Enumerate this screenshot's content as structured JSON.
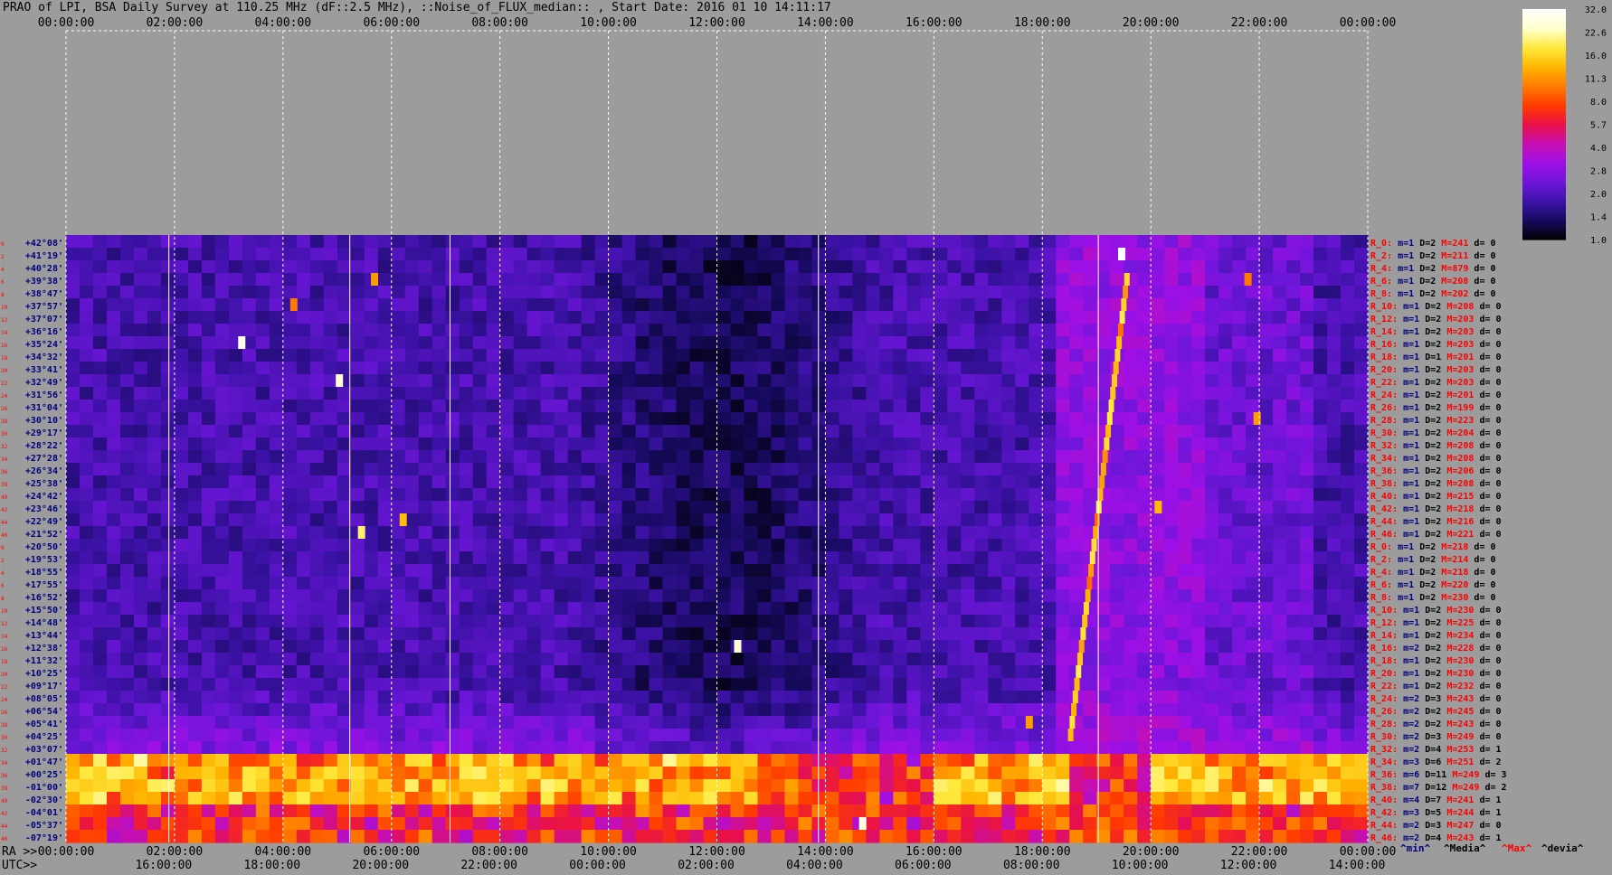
{
  "title": "PRAO of LPI, BSA Daily Survey at 110.25 MHz (dF::2.5 MHz), ::Noise_of_FLUX_median:: , Start Date: 2016 01 10 14:11:17",
  "chart_data": {
    "type": "heatmap",
    "title": "PRAO of LPI, BSA Daily Survey at 110.25 MHz (dF::2.5 MHz), ::Noise_of_FLUX_median:: , Start Date: 2016 01 10 14:11:17",
    "x_ra_ticks": [
      "00:00:00",
      "02:00:00",
      "04:00:00",
      "06:00:00",
      "08:00:00",
      "10:00:00",
      "12:00:00",
      "14:00:00",
      "16:00:00",
      "18:00:00",
      "20:00:00",
      "22:00:00",
      "00:00:00"
    ],
    "x_utc_ticks": [
      "16:00:00",
      "18:00:00",
      "20:00:00",
      "22:00:00",
      "00:00:00",
      "02:00:00",
      "04:00:00",
      "06:00:00",
      "08:00:00",
      "10:00:00",
      "12:00:00",
      "14:00:00"
    ],
    "ra_label": "RA >>",
    "utc_label": "UTC>>",
    "declinations": [
      "+42°08'",
      "+41°19'",
      "+40°28'",
      "+39°38'",
      "+38°47'",
      "+37°57'",
      "+37°07'",
      "+36°16'",
      "+35°24'",
      "+34°32'",
      "+33°41'",
      "+32°49'",
      "+31°56'",
      "+31°04'",
      "+30°10'",
      "+29°17'",
      "+28°22'",
      "+27°28'",
      "+26°34'",
      "+25°38'",
      "+24°42'",
      "+23°46'",
      "+22°49'",
      "+21°52'",
      "+20°50'",
      "+19°53'",
      "+18°55'",
      "+17°55'",
      "+16°52'",
      "+15°50'",
      "+14°48'",
      "+13°44'",
      "+12°38'",
      "+11°32'",
      "+10°25'",
      "+09°17'",
      "+08°05'",
      "+06°54'",
      "+05°41'",
      "+04°25'",
      "+03°07'",
      "+01°47'",
      "+00°25'",
      "-01°00'",
      "-02°30'",
      "-04°01'",
      "-05°37'",
      "-07°19'"
    ],
    "row_stats": [
      {
        "r": "R_0:",
        "m": "m=1",
        "D": "D=2",
        "M": "M=241",
        "d": "d= 0"
      },
      {
        "r": "R_2:",
        "m": "m=1",
        "D": "D=2",
        "M": "M=211",
        "d": "d= 0"
      },
      {
        "r": "R_4:",
        "m": "m=1",
        "D": "D=2",
        "M": "M=879",
        "d": "d= 0"
      },
      {
        "r": "R_6:",
        "m": "m=1",
        "D": "D=2",
        "M": "M=208",
        "d": "d= 0"
      },
      {
        "r": "R_8:",
        "m": "m=1",
        "D": "D=2",
        "M": "M=202",
        "d": "d= 0"
      },
      {
        "r": "R_10:",
        "m": "m=1",
        "D": "D=2",
        "M": "M=208",
        "d": "d= 0"
      },
      {
        "r": "R_12:",
        "m": "m=1",
        "D": "D=2",
        "M": "M=203",
        "d": "d= 0"
      },
      {
        "r": "R_14:",
        "m": "m=1",
        "D": "D=2",
        "M": "M=203",
        "d": "d= 0"
      },
      {
        "r": "R_16:",
        "m": "m=1",
        "D": "D=2",
        "M": "M=203",
        "d": "d= 0"
      },
      {
        "r": "R_18:",
        "m": "m=1",
        "D": "D=1",
        "M": "M=201",
        "d": "d= 0"
      },
      {
        "r": "R_20:",
        "m": "m=1",
        "D": "D=2",
        "M": "M=203",
        "d": "d= 0"
      },
      {
        "r": "R_22:",
        "m": "m=1",
        "D": "D=2",
        "M": "M=203",
        "d": "d= 0"
      },
      {
        "r": "R_24:",
        "m": "m=1",
        "D": "D=2",
        "M": "M=201",
        "d": "d= 0"
      },
      {
        "r": "R_26:",
        "m": "m=1",
        "D": "D=2",
        "M": "M=199",
        "d": "d= 0"
      },
      {
        "r": "R_28:",
        "m": "m=1",
        "D": "D=2",
        "M": "M=223",
        "d": "d= 0"
      },
      {
        "r": "R_30:",
        "m": "m=1",
        "D": "D=2",
        "M": "M=204",
        "d": "d= 0"
      },
      {
        "r": "R_32:",
        "m": "m=1",
        "D": "D=2",
        "M": "M=208",
        "d": "d= 0"
      },
      {
        "r": "R_34:",
        "m": "m=1",
        "D": "D=2",
        "M": "M=208",
        "d": "d= 0"
      },
      {
        "r": "R_36:",
        "m": "m=1",
        "D": "D=2",
        "M": "M=206",
        "d": "d= 0"
      },
      {
        "r": "R_38:",
        "m": "m=1",
        "D": "D=2",
        "M": "M=208",
        "d": "d= 0"
      },
      {
        "r": "R_40:",
        "m": "m=1",
        "D": "D=2",
        "M": "M=215",
        "d": "d= 0"
      },
      {
        "r": "R_42:",
        "m": "m=1",
        "D": "D=2",
        "M": "M=218",
        "d": "d= 0"
      },
      {
        "r": "R_44:",
        "m": "m=1",
        "D": "D=2",
        "M": "M=216",
        "d": "d= 0"
      },
      {
        "r": "R_46:",
        "m": "m=1",
        "D": "D=2",
        "M": "M=221",
        "d": "d= 0"
      },
      {
        "r": "R_0:",
        "m": "m=1",
        "D": "D=2",
        "M": "M=218",
        "d": "d= 0"
      },
      {
        "r": "R_2:",
        "m": "m=1",
        "D": "D=2",
        "M": "M=214",
        "d": "d= 0"
      },
      {
        "r": "R_4:",
        "m": "m=1",
        "D": "D=2",
        "M": "M=218",
        "d": "d= 0"
      },
      {
        "r": "R_6:",
        "m": "m=1",
        "D": "D=2",
        "M": "M=220",
        "d": "d= 0"
      },
      {
        "r": "R_8:",
        "m": "m=1",
        "D": "D=2",
        "M": "M=230",
        "d": "d= 0"
      },
      {
        "r": "R_10:",
        "m": "m=1",
        "D": "D=2",
        "M": "M=230",
        "d": "d= 0"
      },
      {
        "r": "R_12:",
        "m": "m=1",
        "D": "D=2",
        "M": "M=225",
        "d": "d= 0"
      },
      {
        "r": "R_14:",
        "m": "m=1",
        "D": "D=2",
        "M": "M=234",
        "d": "d= 0"
      },
      {
        "r": "R_16:",
        "m": "m=2",
        "D": "D=2",
        "M": "M=228",
        "d": "d= 0"
      },
      {
        "r": "R_18:",
        "m": "m=1",
        "D": "D=2",
        "M": "M=230",
        "d": "d= 0"
      },
      {
        "r": "R_20:",
        "m": "m=1",
        "D": "D=2",
        "M": "M=230",
        "d": "d= 0"
      },
      {
        "r": "R_22:",
        "m": "m=1",
        "D": "D=2",
        "M": "M=232",
        "d": "d= 0"
      },
      {
        "r": "R_24:",
        "m": "m=2",
        "D": "D=3",
        "M": "M=243",
        "d": "d= 0"
      },
      {
        "r": "R_26:",
        "m": "m=2",
        "D": "D=2",
        "M": "M=245",
        "d": "d= 0"
      },
      {
        "r": "R_28:",
        "m": "m=2",
        "D": "D=2",
        "M": "M=243",
        "d": "d= 0"
      },
      {
        "r": "R_30:",
        "m": "m=2",
        "D": "D=3",
        "M": "M=249",
        "d": "d= 0"
      },
      {
        "r": "R_32:",
        "m": "m=2",
        "D": "D=4",
        "M": "M=253",
        "d": "d= 1"
      },
      {
        "r": "R_34:",
        "m": "m=3",
        "D": "D=6",
        "M": "M=251",
        "d": "d= 2"
      },
      {
        "r": "R_36:",
        "m": "m=6",
        "D": "D=11",
        "M": "M=249",
        "d": "d= 3"
      },
      {
        "r": "R_38:",
        "m": "m=7",
        "D": "D=12",
        "M": "M=249",
        "d": "d= 2"
      },
      {
        "r": "R_40:",
        "m": "m=4",
        "D": "D=7",
        "M": "M=241",
        "d": "d= 1"
      },
      {
        "r": "R_42:",
        "m": "m=3",
        "D": "D=5",
        "M": "M=244",
        "d": "d= 1"
      },
      {
        "r": "R_44:",
        "m": "m=2",
        "D": "D=3",
        "M": "M=247",
        "d": "d= 0"
      },
      {
        "r": "R_46:",
        "m": "m=2",
        "D": "D=4",
        "M": "M=243",
        "d": "d= 1"
      }
    ],
    "row_numbers": [
      "0",
      "2",
      "4",
      "6",
      "8",
      "10",
      "12",
      "14",
      "16",
      "18",
      "20",
      "22",
      "24",
      "26",
      "28",
      "30",
      "32",
      "34",
      "36",
      "38",
      "40",
      "42",
      "44",
      "46",
      "0",
      "2",
      "4",
      "6",
      "8",
      "10",
      "12",
      "14",
      "16",
      "18",
      "20",
      "22",
      "24",
      "26",
      "28",
      "30",
      "32",
      "34",
      "36",
      "38",
      "40",
      "42",
      "44",
      "46"
    ],
    "colorbar": {
      "ticks": [
        "32.0",
        "22.6",
        "16.0",
        "11.3",
        "8.0",
        "5.7",
        "4.0",
        "2.8",
        "2.0",
        "1.4",
        "1.0"
      ],
      "scale": "log",
      "range": [
        1.0,
        32.0
      ],
      "colormap": [
        "#000000",
        "#150a5a",
        "#3c12a6",
        "#6c16d8",
        "#9b10e6",
        "#c40fb4",
        "#e8104a",
        "#ff3a00",
        "#ff7a00",
        "#ffb400",
        "#ffe83a",
        "#ffffc8",
        "#ffffff"
      ]
    },
    "stats_legend": {
      "min": "^min^",
      "median": "^Media^",
      "max": "^Max^",
      "dev": "^devia^"
    }
  },
  "colors": {
    "background": "#9c9c9c",
    "label_red": "#ff0000",
    "label_navy": "#000080",
    "grid": "#ffffff"
  }
}
